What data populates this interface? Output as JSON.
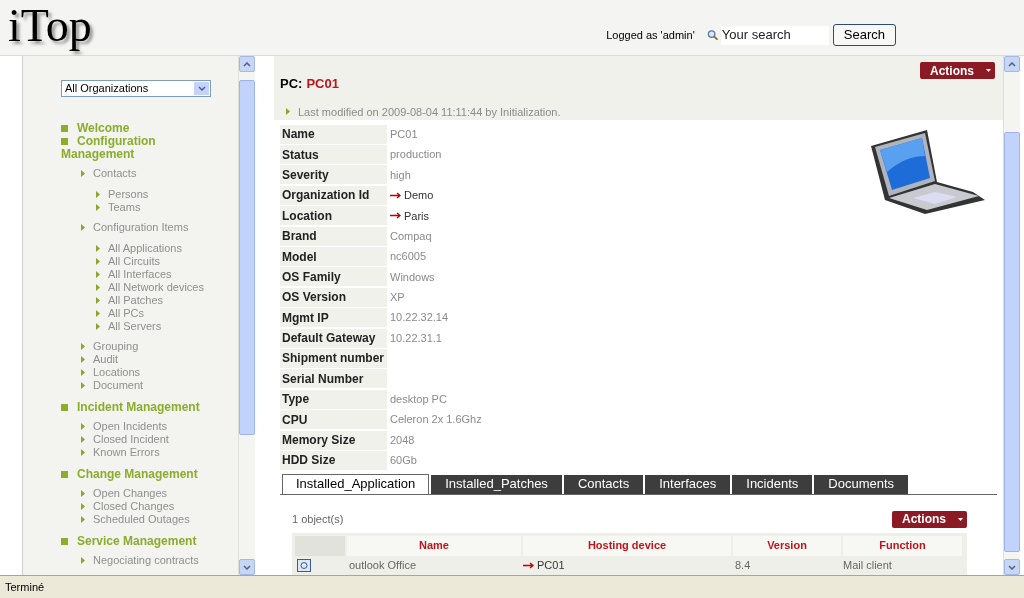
{
  "header": {
    "logo": "iTop",
    "logged_as": "Logged as 'admin'",
    "search": {
      "placeholder": "Your search"
    },
    "search_button": "Search"
  },
  "sidebar": {
    "organization_select": "All Organizations",
    "menu": [
      {
        "label": "Welcome"
      },
      {
        "label": "Configuration Management",
        "children": [
          {
            "label": "Contacts",
            "children": [
              {
                "label": "Persons"
              },
              {
                "label": "Teams"
              }
            ]
          },
          {
            "label": "Configuration Items",
            "children": [
              {
                "label": "All Applications"
              },
              {
                "label": "All Circuits"
              },
              {
                "label": "All Interfaces"
              },
              {
                "label": "All Network devices"
              },
              {
                "label": "All Patches"
              },
              {
                "label": "All PCs"
              },
              {
                "label": "All Servers"
              }
            ]
          },
          {
            "label": "Grouping"
          },
          {
            "label": "Audit"
          },
          {
            "label": "Locations"
          },
          {
            "label": "Document"
          }
        ]
      },
      {
        "label": "Incident Management",
        "children": [
          {
            "label": "Open Incidents"
          },
          {
            "label": "Closed Incident"
          },
          {
            "label": "Known Errors"
          }
        ]
      },
      {
        "label": "Change Management",
        "children": [
          {
            "label": "Open Changes"
          },
          {
            "label": "Closed Changes"
          },
          {
            "label": "Scheduled Outages"
          }
        ]
      },
      {
        "label": "Service Management",
        "children": [
          {
            "label": "Negociating contracts"
          }
        ]
      }
    ]
  },
  "object": {
    "class_label": "PC:",
    "name": "PC01",
    "actions_button": "Actions",
    "last_modified": "Last modified on 2009-08-04 11:11:44 by Initialization.",
    "fields": [
      {
        "label": "Name",
        "value": "PC01",
        "kind": "text"
      },
      {
        "label": "Status",
        "value": "production",
        "kind": "text"
      },
      {
        "label": "Severity",
        "value": "high",
        "kind": "text"
      },
      {
        "label": "Organization Id",
        "value": "Demo",
        "kind": "link"
      },
      {
        "label": "Location",
        "value": "Paris",
        "kind": "link"
      },
      {
        "label": "Brand",
        "value": "Compaq",
        "kind": "text"
      },
      {
        "label": "Model",
        "value": "nc6005",
        "kind": "text"
      },
      {
        "label": "OS Family",
        "value": "Windows",
        "kind": "text"
      },
      {
        "label": "OS Version",
        "value": "XP",
        "kind": "text"
      },
      {
        "label": "Mgmt IP",
        "value": "10.22.32.14",
        "kind": "text"
      },
      {
        "label": "Default Gateway",
        "value": "10.22.31.1",
        "kind": "text"
      },
      {
        "label": "Shipment number"
      },
      {
        "label": "Serial Number"
      },
      {
        "label": "Type",
        "value": "desktop PC",
        "kind": "text"
      },
      {
        "label": "CPU",
        "value": "Celeron 2x 1.6Ghz",
        "kind": "text"
      },
      {
        "label": "Memory Size",
        "value": "2048",
        "kind": "text"
      },
      {
        "label": "HDD Size",
        "value": "60Gb",
        "kind": "text"
      }
    ]
  },
  "tabs": [
    {
      "label": "Installed_Application",
      "selected": true
    },
    {
      "label": "Installed_Patches",
      "selected": false
    },
    {
      "label": "Contacts",
      "selected": false
    },
    {
      "label": "Interfaces",
      "selected": false
    },
    {
      "label": "Incidents",
      "selected": false
    },
    {
      "label": "Documents",
      "selected": false
    }
  ],
  "list": {
    "count": "1 object(s)",
    "actions_button": "Actions",
    "columns": [
      "Name",
      "Hosting device",
      "Version",
      "Function"
    ],
    "rows": [
      {
        "name": "outlook Office",
        "hosting_device": "PC01",
        "version": "8.4",
        "function": "Mail client"
      }
    ]
  },
  "status_bar": "Terminé"
}
